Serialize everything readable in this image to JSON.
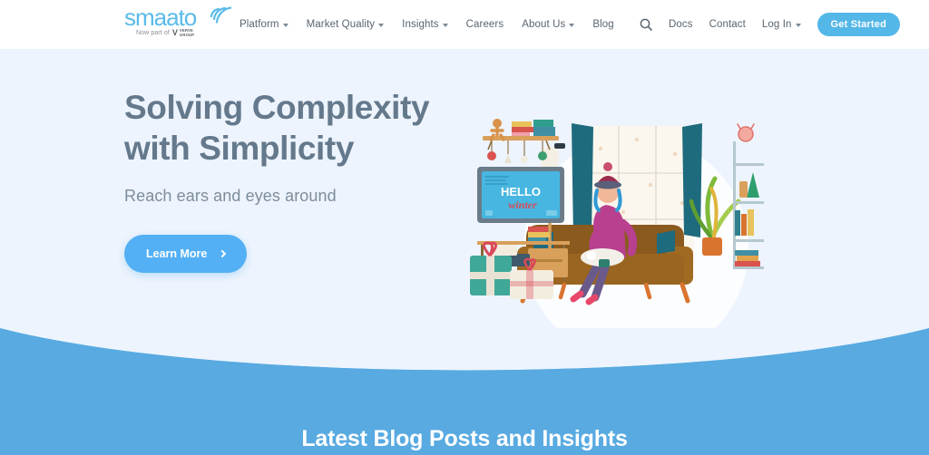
{
  "brand": {
    "logo_text": "smaato",
    "logo_tagline": "Now part of",
    "partner_name_line1": "VERVE",
    "partner_name_line2": "GROUP",
    "partner_initial": "V"
  },
  "nav": {
    "left_items": [
      {
        "label": "Platform",
        "has_dropdown": true
      },
      {
        "label": "Market Quality",
        "has_dropdown": true
      },
      {
        "label": "Insights",
        "has_dropdown": true
      },
      {
        "label": "Careers",
        "has_dropdown": false
      },
      {
        "label": "About Us",
        "has_dropdown": true
      },
      {
        "label": "Blog",
        "has_dropdown": false
      }
    ],
    "right_items": [
      {
        "label": "Docs",
        "has_dropdown": false
      },
      {
        "label": "Contact",
        "has_dropdown": false
      },
      {
        "label": "Log In",
        "has_dropdown": true
      }
    ],
    "search_icon": "search-icon",
    "cta_label": "Get Started"
  },
  "hero": {
    "title_line1": "Solving Complexity",
    "title_line2": "with Simplicity",
    "subtitle": "Reach ears and eyes around",
    "cta_label": "Learn More",
    "cta_icon": "chevron-right-icon",
    "illustration": {
      "name": "winter-living-room-illustration",
      "tv_text_line1": "HELLO",
      "tv_text_line2": "winter"
    }
  },
  "blog_section": {
    "heading": "Latest Blog Posts and Insights"
  },
  "colors": {
    "brand_blue": "#53b7e8",
    "button_blue": "#53b0f5",
    "band_blue": "#58aae1",
    "hero_bg": "#edf4fd",
    "heading_slate": "#65798c",
    "nav_text": "#5a6570",
    "header_white": "#ffffff"
  }
}
